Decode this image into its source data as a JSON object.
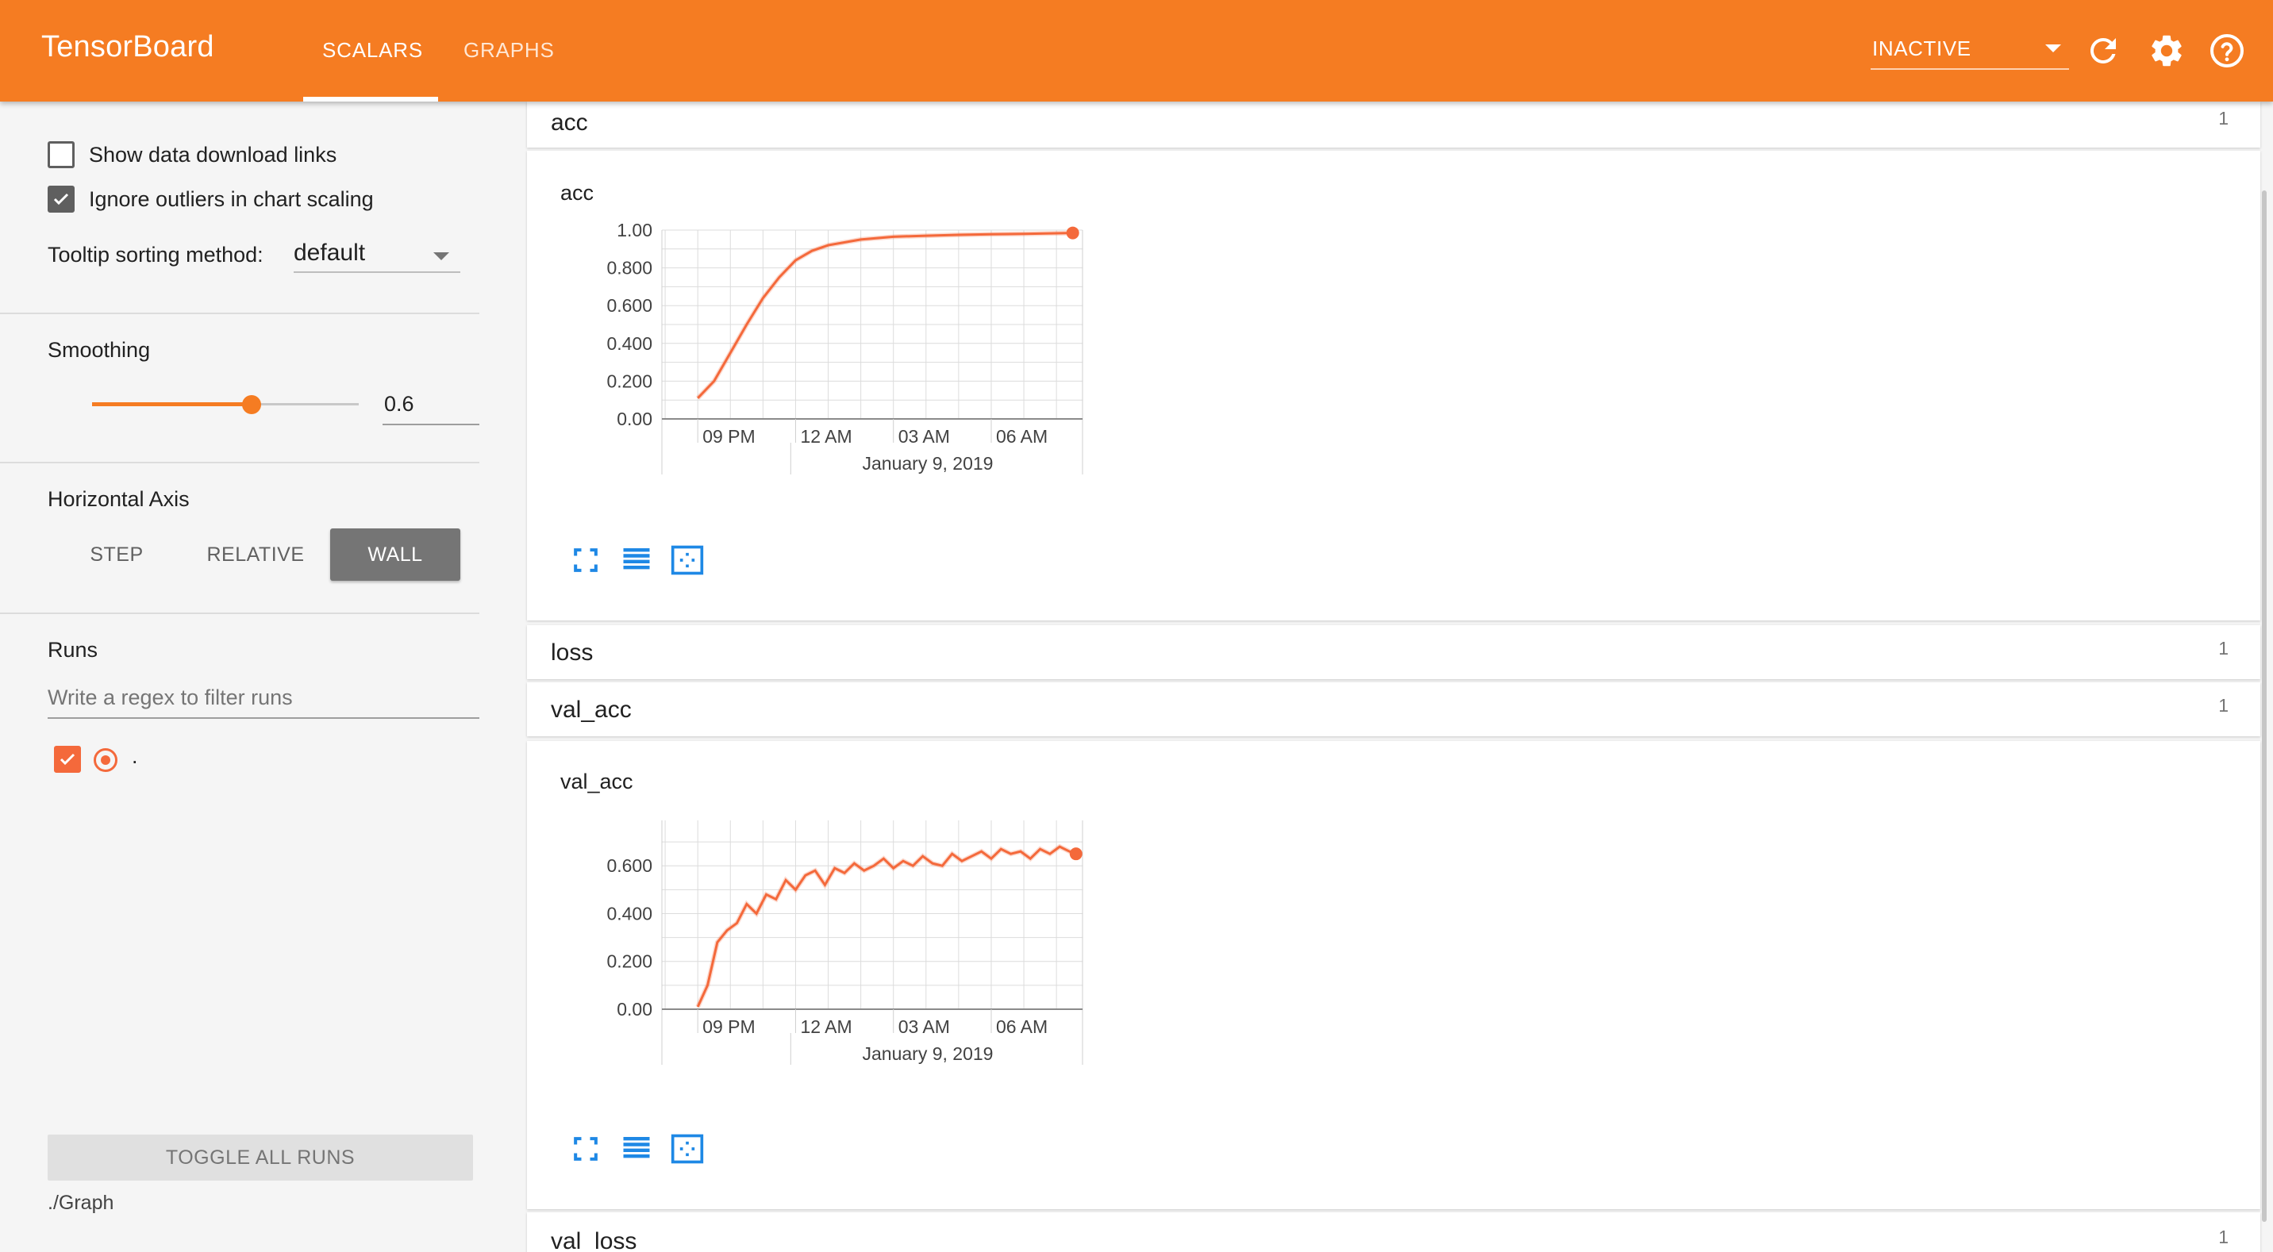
{
  "app": {
    "title": "TensorBoard",
    "tabs": [
      {
        "label": "SCALARS",
        "active": true
      },
      {
        "label": "GRAPHS",
        "active": false
      }
    ],
    "status": "INACTIVE",
    "icons": [
      "refresh-icon",
      "gear-icon",
      "help-icon"
    ],
    "accent": "#f57c22"
  },
  "sidebar": {
    "show_download_label": "Show data download links",
    "show_download_checked": false,
    "ignore_outliers_label": "Ignore outliers in chart scaling",
    "ignore_outliers_checked": true,
    "tooltip_label": "Tooltip sorting method:",
    "tooltip_value": "default",
    "smoothing_title": "Smoothing",
    "smoothing_value": "0.6",
    "smoothing_fraction": 0.6,
    "axis_title": "Horizontal Axis",
    "axis_options": [
      "STEP",
      "RELATIVE",
      "WALL"
    ],
    "axis_selected": "WALL",
    "runs_title": "Runs",
    "filter_placeholder": "Write a regex to filter runs",
    "runs": [
      {
        "name": ".",
        "checked": true,
        "color": "#f4693b"
      }
    ],
    "toggle_all_label": "TOGGLE ALL RUNS",
    "graph_dir": "./Graph"
  },
  "main": {
    "groups": [
      {
        "name": "acc",
        "count": "1"
      },
      {
        "name": "loss",
        "count": "1"
      },
      {
        "name": "val_acc",
        "count": "1"
      },
      {
        "name": "val_loss",
        "count": "1"
      }
    ]
  },
  "chart_data": [
    {
      "type": "line",
      "title": "acc",
      "xaxis_date_label": "January 9, 2019",
      "x_tick_labels": [
        "09 PM",
        "12 AM",
        "03 AM",
        "06 AM"
      ],
      "y_tick_labels": [
        "0.00",
        "0.200",
        "0.400",
        "0.600",
        "0.800",
        "1.00"
      ],
      "x_hours_from_9pm": [
        0,
        0.5,
        1,
        1.5,
        2,
        2.5,
        3,
        3.5,
        4,
        5,
        6,
        7,
        8,
        9,
        10,
        11,
        11.5
      ],
      "values": [
        0.11,
        0.2,
        0.35,
        0.5,
        0.64,
        0.75,
        0.84,
        0.89,
        0.92,
        0.95,
        0.965,
        0.97,
        0.975,
        0.978,
        0.98,
        0.983,
        0.985
      ],
      "ylim": [
        0,
        1.0
      ],
      "xlim_hours": [
        -1.1,
        11.8
      ],
      "color": "#f4693b",
      "grid": true
    },
    {
      "type": "line",
      "title": "val_acc",
      "xaxis_date_label": "January 9, 2019",
      "x_tick_labels": [
        "09 PM",
        "12 AM",
        "03 AM",
        "06 AM"
      ],
      "y_tick_labels": [
        "0.00",
        "0.200",
        "0.400",
        "0.600"
      ],
      "x_hours_from_9pm": [
        0,
        0.3,
        0.6,
        0.9,
        1.2,
        1.5,
        1.8,
        2.1,
        2.4,
        2.7,
        3.0,
        3.3,
        3.6,
        3.9,
        4.2,
        4.5,
        4.8,
        5.1,
        5.4,
        5.7,
        6.0,
        6.3,
        6.6,
        6.9,
        7.2,
        7.5,
        7.8,
        8.1,
        8.4,
        8.7,
        9.0,
        9.3,
        9.6,
        9.9,
        10.2,
        10.5,
        10.8,
        11.1,
        11.4,
        11.6
      ],
      "values": [
        0.01,
        0.1,
        0.28,
        0.33,
        0.36,
        0.44,
        0.4,
        0.48,
        0.46,
        0.54,
        0.5,
        0.56,
        0.58,
        0.52,
        0.59,
        0.57,
        0.61,
        0.58,
        0.6,
        0.63,
        0.59,
        0.62,
        0.6,
        0.64,
        0.61,
        0.6,
        0.65,
        0.62,
        0.64,
        0.66,
        0.63,
        0.67,
        0.65,
        0.66,
        0.63,
        0.67,
        0.65,
        0.68,
        0.66,
        0.65
      ],
      "ylim": [
        0,
        0.79
      ],
      "xlim_hours": [
        -1.1,
        11.8
      ],
      "color": "#f4693b",
      "grid": true
    }
  ]
}
